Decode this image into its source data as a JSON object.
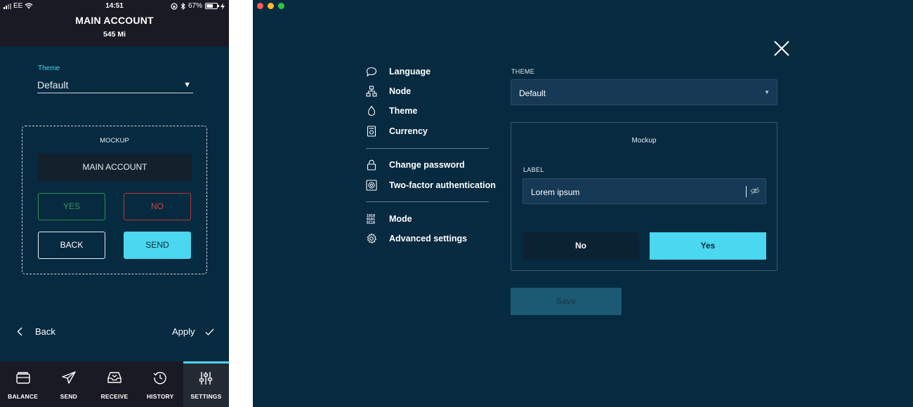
{
  "mobile": {
    "status": {
      "carrier": "EE",
      "time": "14:51",
      "battery": "67%",
      "battery_level": 0.67
    },
    "header": {
      "title": "MAIN ACCOUNT",
      "balance": "545 Mi"
    },
    "theme": {
      "label": "Theme",
      "value": "Default"
    },
    "mockup": {
      "title": "MOCKUP",
      "account": "MAIN ACCOUNT",
      "yes": "YES",
      "no": "NO",
      "back": "BACK",
      "send": "SEND"
    },
    "footer": {
      "back": "Back",
      "apply": "Apply"
    },
    "tabs": [
      {
        "label": "BALANCE",
        "icon": "wallet-icon"
      },
      {
        "label": "SEND",
        "icon": "paper-plane-icon"
      },
      {
        "label": "RECEIVE",
        "icon": "inbox-icon"
      },
      {
        "label": "HISTORY",
        "icon": "history-icon"
      },
      {
        "label": "SETTINGS",
        "icon": "sliders-icon",
        "active": true
      }
    ]
  },
  "desktop": {
    "window_dots": {
      "colors": [
        "#fd5f57",
        "#febc2e",
        "#28c840"
      ]
    },
    "menu": {
      "items": [
        {
          "label": "Language",
          "icon": "speech-bubble-icon"
        },
        {
          "label": "Node",
          "icon": "network-icon"
        },
        {
          "label": "Theme",
          "icon": "droplet-icon"
        },
        {
          "label": "Currency",
          "icon": "currency-icon"
        },
        {
          "label": "Change password",
          "icon": "lock-icon"
        },
        {
          "label": "Two-factor authentication",
          "icon": "safe-icon"
        },
        {
          "label": "Mode",
          "icon": "binary-icon"
        },
        {
          "label": "Advanced settings",
          "icon": "gear-icon"
        }
      ]
    },
    "theme": {
      "label": "THEME",
      "value": "Default"
    },
    "mockup": {
      "title": "Mockup",
      "field_label": "LABEL",
      "field_value": "Lorem ipsum",
      "no": "No",
      "yes": "Yes"
    },
    "save": "Save"
  },
  "colors": {
    "accent": "#4ad7ef",
    "background": "#062a40",
    "yes_green": "#2f9a58",
    "no_red": "#c94848"
  }
}
